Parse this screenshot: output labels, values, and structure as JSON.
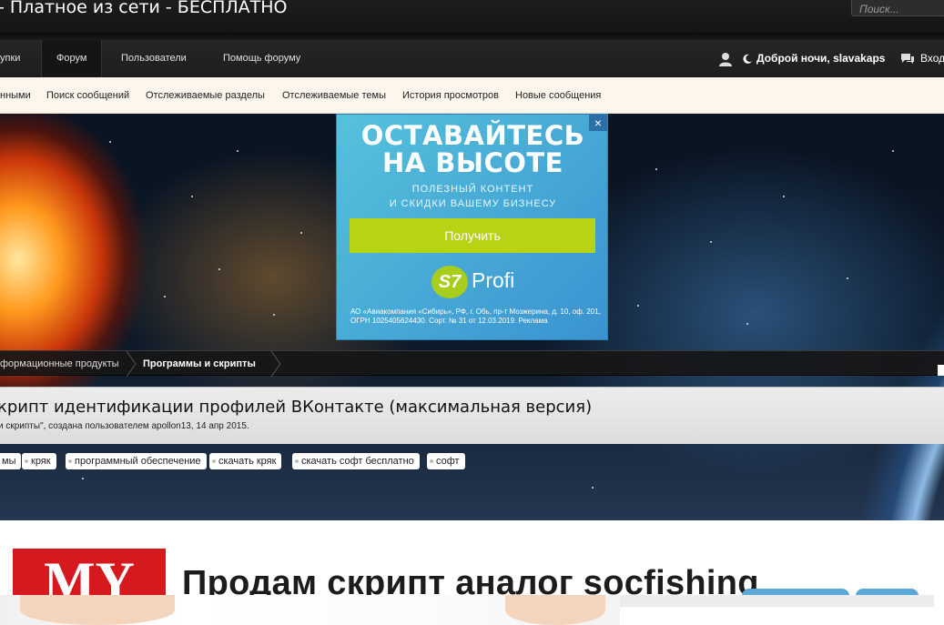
{
  "header": {
    "site_title": "- Платное из сети - БЕСПЛАТНО",
    "search_placeholder": "Поиск..."
  },
  "nav": {
    "tabs": [
      {
        "label": "упки"
      },
      {
        "label": "Форум",
        "active": true
      },
      {
        "label": "Пользователи"
      },
      {
        "label": "Помощь форуму"
      }
    ],
    "greeting": "Доброй ночи, slavakaps",
    "inbox": "Вход"
  },
  "subnav": {
    "items": [
      "нными",
      "Поиск сообщений",
      "Отслеживаемые разделы",
      "Отслеживаемые темы",
      "История просмотров",
      "Новые сообщения"
    ]
  },
  "ad": {
    "headline_line1": "ОСТАВАЙТЕСЬ",
    "headline_line2": "НА ВЫСОТЕ",
    "sub_line1": "ПОЛЕЗНЫЙ КОНТЕНТ",
    "sub_line2": "И СКИДКИ ВАШЕМУ БИЗНЕСУ",
    "button": "Получить",
    "logo_mark": "S7",
    "logo_text": "Profi",
    "close": "×",
    "fine_print": "АО «Авиакомпания «Сибирь», РФ, г. Обь, пр-т Мозжерина, д. 10, оф. 201, ОГРН 1025405624430. Сорт. № 31 от 12.03.2019. Реклама"
  },
  "breadcrumb": {
    "items": [
      "формационные продукты",
      "Программы и скрипты"
    ]
  },
  "thread": {
    "title": "крипт идентификации профилей ВКонтакте (максимальная версия)",
    "meta": "и скрипты\", создана пользователем apollon13, 14 апр 2015."
  },
  "tags": [
    "мы",
    "кряк",
    "программный обеспечение",
    "скачать кряк",
    "скачать софт бесплатно",
    "софт"
  ],
  "lower": {
    "logo_text": "MY",
    "title": "Продам скрипт аналог socfishing"
  },
  "colors": {
    "nav_bg": "#1e1e1e",
    "subnav_bg": "#fdf6ec",
    "ad_bg": "#3a92d0",
    "ad_button": "#b7d313",
    "logo_red": "#d6181f"
  }
}
